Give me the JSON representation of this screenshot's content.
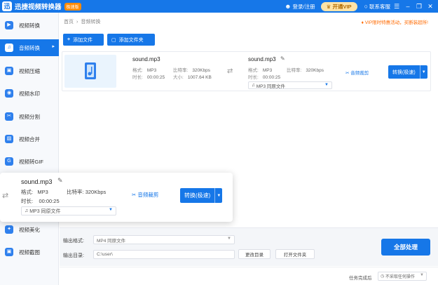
{
  "titlebar": {
    "app_title": "迅捷视频转换器",
    "badge": "极速版",
    "login": "登录/注册",
    "vip": "开通VIP",
    "service": "联系客服",
    "menu_icon": "menu-icon",
    "min_icon": "minimize-icon",
    "max_icon": "restore-icon",
    "close_icon": "close-icon"
  },
  "sidebar": {
    "items": [
      {
        "label": "视频转换",
        "icon": "video-convert-icon"
      },
      {
        "label": "音频转换",
        "icon": "audio-convert-icon"
      },
      {
        "label": "视频压缩",
        "icon": "compress-icon"
      },
      {
        "label": "视频水印",
        "icon": "watermark-icon"
      },
      {
        "label": "视频分割",
        "icon": "split-icon"
      },
      {
        "label": "视频合并",
        "icon": "merge-icon"
      },
      {
        "label": "视频转GIF",
        "icon": "gif-icon"
      },
      {
        "label": "视频美化",
        "icon": "beautify-icon"
      },
      {
        "label": "视频截图",
        "icon": "screenshot-icon"
      }
    ]
  },
  "breadcrumb": {
    "home": "首页",
    "current": "音频转换"
  },
  "vip_tip": "VIP限时特惠活动，买断装超所!",
  "toolbar": {
    "add_file": "添加文件",
    "add_folder": "添加文件夹"
  },
  "file": {
    "src_name": "sound.mp3",
    "src_format_label": "格式:",
    "src_format": "MP3",
    "src_bitrate_label": "比特率:",
    "src_bitrate": "320Kbps",
    "src_duration_label": "时长:",
    "src_duration": "00:00:25",
    "src_size_label": "大小:",
    "src_size": "1007.64 KB",
    "dst_name": "sound.mp3",
    "dst_format_label": "格式:",
    "dst_format": "MP3",
    "dst_bitrate_label": "比特率:",
    "dst_bitrate": "320Kbps",
    "dst_duration_label": "时长:",
    "dst_duration": "00:00:25",
    "output_select": "MP3  同原文件",
    "audio_cut": "音频裁剪",
    "convert": "转换(极速)"
  },
  "bottom": {
    "format_label": "输出格式:",
    "format_value": "MP4  同原文件",
    "dir_label": "输出目录:",
    "dir_value": "C:\\user\\",
    "change_dir": "更改目录",
    "open_folder": "打开文件夹",
    "convert_all": "全部处理"
  },
  "status": {
    "label": "任务完成后",
    "value": "不采取任何操作"
  },
  "colors": {
    "accent": "#1677e8",
    "vip": "#ffe4a8",
    "tip": "#ff6a00"
  }
}
